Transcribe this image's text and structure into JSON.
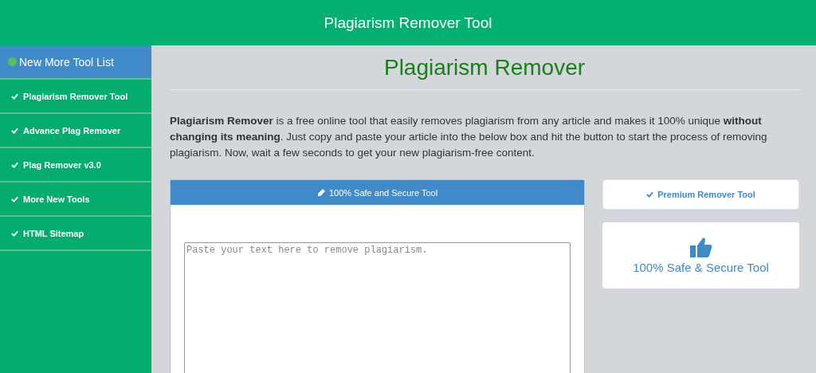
{
  "header": {
    "title": "Plagiarism Remover Tool"
  },
  "sidebar": {
    "title": "New More Tool List",
    "items": [
      {
        "label": "Plagiarism Remover Tool"
      },
      {
        "label": "Advance Plag Remover"
      },
      {
        "label": "Plag Remover v3.0"
      },
      {
        "label": "More New Tools"
      },
      {
        "label": "HTML Sitemap"
      }
    ]
  },
  "main": {
    "heading": "Plagiarism Remover",
    "intro": "**Plagiarism Remover** is a free online tool that easily removes plagiarism from any article and makes it 100% unique **without changing its meaning**. Just copy and paste your article into the below box and hit the button to start the process of removing plagiarism. Now, wait a few seconds to get your new plagiarism-free content.",
    "tool_card": {
      "title": "100% Safe and Secure Tool",
      "placeholder": "Paste your text here to remove plagiarism."
    },
    "premium_button": "Premium Remover Tool",
    "safe_card": "100% Safe & Secure Tool"
  }
}
